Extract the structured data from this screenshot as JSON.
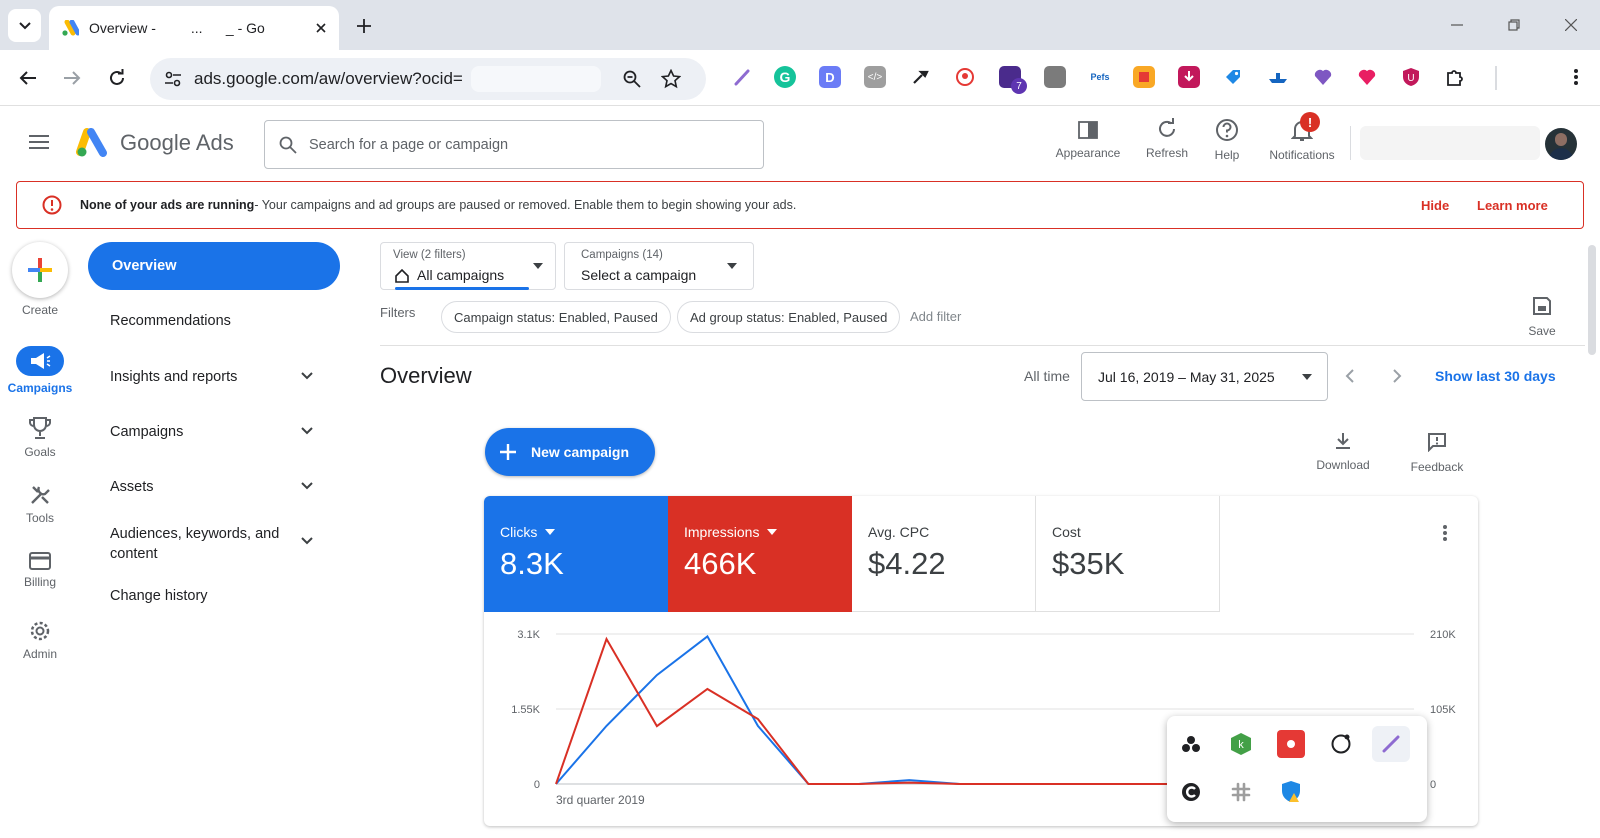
{
  "browser": {
    "tab_title": "Overview -         ...      _ - Go",
    "url": "ads.google.com/aw/overview?ocid=",
    "extension_badge": "7"
  },
  "header": {
    "logo_text": "Google Ads",
    "search_placeholder": "Search for a page or campaign",
    "appearance": "Appearance",
    "refresh": "Refresh",
    "help": "Help",
    "notifications": "Notifications",
    "notifications_badge": "!"
  },
  "alert": {
    "bold": "None of your ads are running",
    "text": " - Your campaigns and ad groups are paused or removed. Enable them to begin showing your ads.",
    "hide": "Hide",
    "learn_more": "Learn more"
  },
  "rail": {
    "create": "Create",
    "campaigns": "Campaigns",
    "goals": "Goals",
    "tools": "Tools",
    "billing": "Billing",
    "admin": "Admin"
  },
  "sidenav": {
    "overview": "Overview",
    "recommendations": "Recommendations",
    "insights": "Insights and reports",
    "campaigns": "Campaigns",
    "assets": "Assets",
    "audiences_1": "Audiences, keywords, and",
    "audiences_2": "content",
    "change_history": "Change history"
  },
  "view_selector": {
    "caption": "View (2 filters)",
    "value": "All campaigns"
  },
  "campaign_selector": {
    "caption": "Campaigns (14)",
    "value": "Select a campaign"
  },
  "filters": {
    "label": "Filters",
    "chips": [
      "Campaign status: Enabled, Paused",
      "Ad group status: Enabled, Paused"
    ],
    "add": "Add filter"
  },
  "save": "Save",
  "page_title": "Overview",
  "date": {
    "label": "All time",
    "range": "Jul 16, 2019 – May 31, 2025",
    "show_last": "Show last 30 days"
  },
  "new_campaign": "New campaign",
  "download": "Download",
  "feedback": "Feedback",
  "metrics": [
    {
      "title": "Clicks",
      "value": "8.3K",
      "color": "#1a73e8"
    },
    {
      "title": "Impressions",
      "value": "466K",
      "color": "#d93025"
    },
    {
      "title": "Avg. CPC",
      "value": "$4.22"
    },
    {
      "title": "Cost",
      "value": "$35K"
    }
  ],
  "chart_data": {
    "type": "line",
    "x_label_first": "3rd quarter 2019",
    "left_ticks": [
      "3.1K",
      "1.55K",
      "0"
    ],
    "right_ticks": [
      "210K",
      "105K",
      "0"
    ],
    "left_ylim": [
      0,
      3100
    ],
    "right_ylim": [
      0,
      210000
    ],
    "series": [
      {
        "name": "Clicks",
        "color": "#1a73e8",
        "axis": "left",
        "values": [
          0,
          1200,
          2250,
          3050,
          1200,
          0,
          0,
          80,
          0,
          0,
          0,
          0,
          0,
          0,
          0,
          0,
          20,
          700
        ]
      },
      {
        "name": "Impressions",
        "color": "#d93025",
        "axis": "right",
        "values": [
          0,
          203000,
          81000,
          133000,
          91000,
          0,
          0,
          2000,
          0,
          0,
          0,
          0,
          0,
          0,
          0,
          0,
          2500,
          45000
        ]
      }
    ]
  }
}
